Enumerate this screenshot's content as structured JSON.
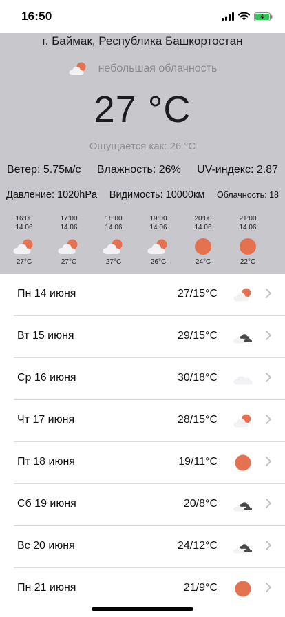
{
  "status_bar": {
    "time": "16:50",
    "icons": [
      "signal-icon",
      "wifi-icon",
      "battery-charging-icon"
    ],
    "battery_color": "#32c759"
  },
  "current": {
    "city": "г. Баймак, Республика Башкортостан",
    "description": "небольшая облачность",
    "description_icon": "partly-cloudy-icon",
    "temperature": "27 °C",
    "feels_like": "Ощущается как: 26 °C",
    "wind": "Ветер: 5.75м/с",
    "humidity": "Влажность: 26%",
    "uv": "UV-индекс: 2.87",
    "pressure": "Давление: 1020hPa",
    "visibility": "Видимость: 10000км",
    "cloudiness": "Облачность: 18",
    "panel_color": "#c8c8cc"
  },
  "hourly": [
    {
      "time": "16:00",
      "date": "14.06",
      "icon": "partly-cloudy-icon",
      "temp": "27°C"
    },
    {
      "time": "17:00",
      "date": "14.06",
      "icon": "partly-cloudy-icon",
      "temp": "27°C"
    },
    {
      "time": "18:00",
      "date": "14.06",
      "icon": "partly-cloudy-icon",
      "temp": "27°C"
    },
    {
      "time": "19:00",
      "date": "14.06",
      "icon": "partly-cloudy-icon",
      "temp": "26°C"
    },
    {
      "time": "20:00",
      "date": "14.06",
      "icon": "sun-icon",
      "temp": "24°C"
    },
    {
      "time": "21:00",
      "date": "14.06",
      "icon": "sun-icon",
      "temp": "22°C"
    }
  ],
  "daily": [
    {
      "label": "Пн 14 июня",
      "temp": "27/15°C",
      "icon": "partly-cloudy-icon"
    },
    {
      "label": "Вт 15 июня",
      "temp": "29/15°C",
      "icon": "broken-clouds-icon"
    },
    {
      "label": "Ср 16 июня",
      "temp": "30/18°C",
      "icon": "cloud-icon"
    },
    {
      "label": "Чт 17 июня",
      "temp": "28/15°C",
      "icon": "partly-cloudy-icon"
    },
    {
      "label": "Пт 18 июня",
      "temp": "19/11°C",
      "icon": "sun-icon"
    },
    {
      "label": "Сб 19 июня",
      "temp": "20/8°C",
      "icon": "broken-clouds-icon"
    },
    {
      "label": "Вс 20 июня",
      "temp": "24/12°C",
      "icon": "broken-clouds-icon"
    },
    {
      "label": "Пн 21 июня",
      "temp": "21/9°C",
      "icon": "sun-icon"
    }
  ],
  "colors": {
    "sun": "#e4714f",
    "cloud": "#f2f2f4",
    "dark_cloud": "#4a4a4c",
    "chevron": "#c4c4c7"
  }
}
